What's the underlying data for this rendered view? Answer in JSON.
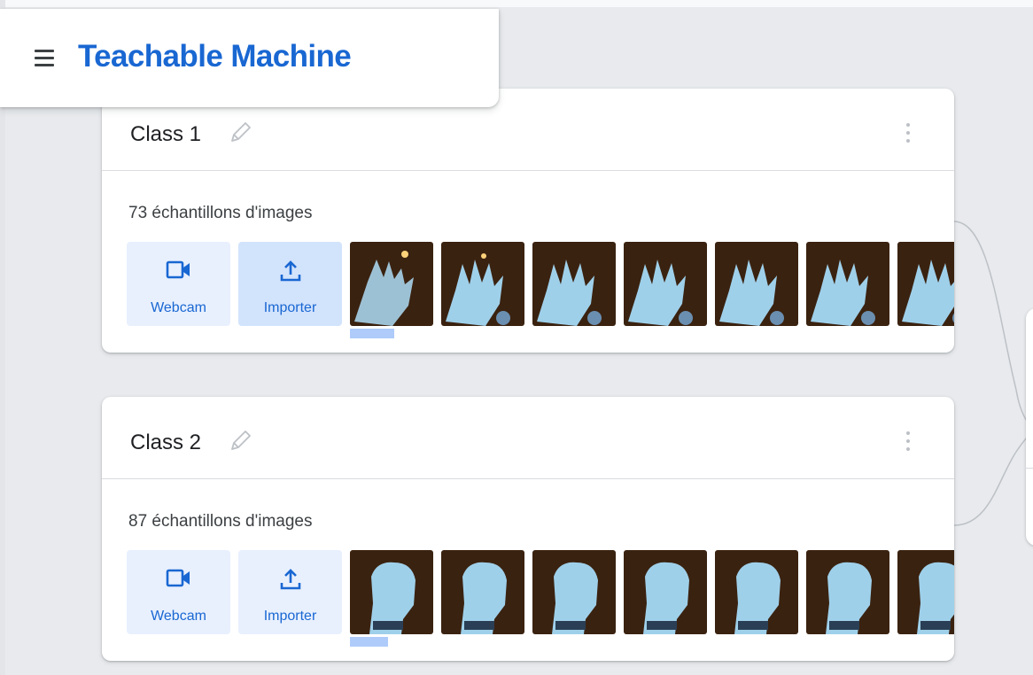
{
  "header": {
    "app_title": "Teachable Machine"
  },
  "classes": [
    {
      "name": "Class 1",
      "samples": "73 échantillons d'images",
      "webcam_label": "Webcam",
      "import_label": "Importer",
      "thumbnails": [
        "hand-open",
        "hand-open",
        "hand-open",
        "hand-open",
        "hand-open",
        "hand-open",
        "hand-open"
      ]
    },
    {
      "name": "Class 2",
      "samples": "87 échantillons d'images",
      "webcam_label": "Webcam",
      "import_label": "Importer",
      "thumbnails": [
        "hand-fist",
        "hand-fist",
        "hand-fist",
        "hand-fist",
        "hand-fist",
        "hand-fist",
        "hand-fist"
      ]
    }
  ],
  "colors": {
    "accent": "#1967d2",
    "button_bg": "#e8f0fe",
    "button_bg_active": "#d2e3fc",
    "background": "#e8eaed"
  }
}
